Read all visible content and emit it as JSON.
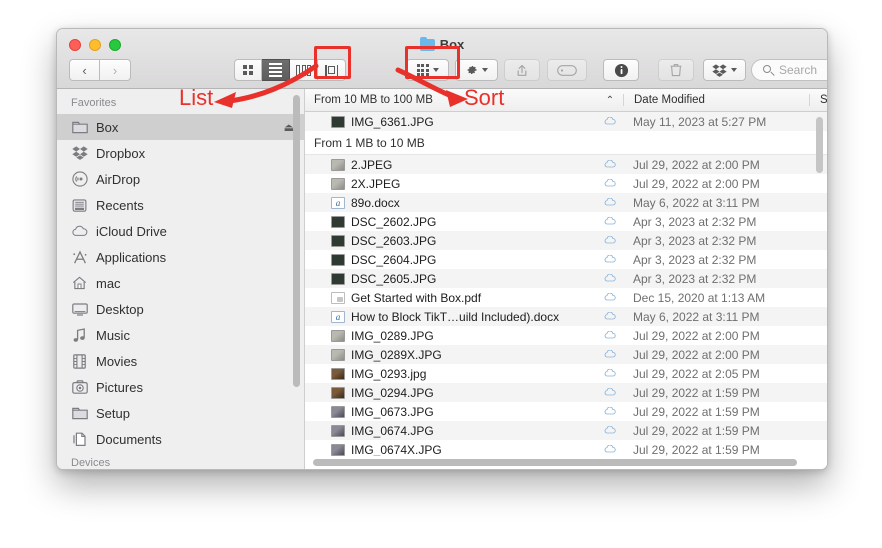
{
  "window": {
    "title": "Box",
    "title_icon": "folder-icon",
    "traffic_lights": [
      "close-button",
      "minimize-button",
      "maximize-button"
    ]
  },
  "toolbar": {
    "back_label": "‹",
    "forward_label": "›",
    "view_modes": [
      {
        "name": "icon-view",
        "label": "Icon View",
        "active": false
      },
      {
        "name": "list-view",
        "label": "List View",
        "active": true
      },
      {
        "name": "column-view",
        "label": "Column View",
        "active": false
      },
      {
        "name": "gallery-view",
        "label": "Gallery View",
        "active": false
      }
    ],
    "sort_button": "Sort",
    "action_button": "Action",
    "share_button": "Share",
    "tag_button": "Tags",
    "info_button": "Info",
    "delete_button": "Delete",
    "dropbox_button": "Dropbox"
  },
  "search": {
    "placeholder": "Search",
    "value": "",
    "icon": "search-icon"
  },
  "sidebar": {
    "section_title": "Favorites",
    "bottom_section_title": "Devices",
    "items": [
      {
        "label": "Box",
        "icon": "folder-icon",
        "selected": true,
        "eject": true
      },
      {
        "label": "Dropbox",
        "icon": "dropbox-icon",
        "selected": false,
        "eject": false
      },
      {
        "label": "AirDrop",
        "icon": "airdrop-icon",
        "selected": false,
        "eject": false
      },
      {
        "label": "Recents",
        "icon": "recents-icon",
        "selected": false,
        "eject": false
      },
      {
        "label": "iCloud Drive",
        "icon": "cloud-icon",
        "selected": false,
        "eject": false
      },
      {
        "label": "Applications",
        "icon": "applications-icon",
        "selected": false,
        "eject": false
      },
      {
        "label": "mac",
        "icon": "home-icon",
        "selected": false,
        "eject": false
      },
      {
        "label": "Desktop",
        "icon": "desktop-icon",
        "selected": false,
        "eject": false
      },
      {
        "label": "Music",
        "icon": "music-icon",
        "selected": false,
        "eject": false
      },
      {
        "label": "Movies",
        "icon": "movies-icon",
        "selected": false,
        "eject": false
      },
      {
        "label": "Pictures",
        "icon": "pictures-icon",
        "selected": false,
        "eject": false
      },
      {
        "label": "Setup",
        "icon": "folder-icon",
        "selected": false,
        "eject": false
      },
      {
        "label": "Documents",
        "icon": "documents-icon",
        "selected": false,
        "eject": false
      }
    ]
  },
  "filelist": {
    "columns": {
      "name": "From 10 MB to 100 MB",
      "sort_indicator": "⌃",
      "date": "Date Modified",
      "size": "S"
    },
    "groups": [
      {
        "header": "From 10 MB to 100 MB",
        "is_header_row": false,
        "rows": [
          {
            "name": "IMG_6361.JPG",
            "icon": "photo-dark",
            "cloud": "cloud-status-icon",
            "date": "May 11, 2023 at 5:27 PM",
            "size": ""
          }
        ]
      },
      {
        "header": "From 1 MB to 10 MB",
        "is_header_row": true,
        "rows": [
          {
            "name": "2.JPEG",
            "icon": "photo-grey",
            "cloud": "cloud-status-icon",
            "date": "Jul 29, 2022 at 2:00 PM",
            "size": ""
          },
          {
            "name": "2X.JPEG",
            "icon": "photo-grey",
            "cloud": "cloud-status-icon",
            "date": "Jul 29, 2022 at 2:00 PM",
            "size": ""
          },
          {
            "name": "89o.docx",
            "icon": "doc-word",
            "cloud": "cloud-status-icon",
            "date": "May 6, 2022 at 3:11 PM",
            "size": ""
          },
          {
            "name": "DSC_2602.JPG",
            "icon": "photo-dark",
            "cloud": "cloud-status-icon",
            "date": "Apr 3, 2023 at 2:32 PM",
            "size": ""
          },
          {
            "name": "DSC_2603.JPG",
            "icon": "photo-dark",
            "cloud": "cloud-status-icon",
            "date": "Apr 3, 2023 at 2:32 PM",
            "size": ""
          },
          {
            "name": "DSC_2604.JPG",
            "icon": "photo-dark",
            "cloud": "cloud-status-icon",
            "date": "Apr 3, 2023 at 2:32 PM",
            "size": ""
          },
          {
            "name": "DSC_2605.JPG",
            "icon": "photo-dark",
            "cloud": "cloud-status-icon",
            "date": "Apr 3, 2023 at 2:32 PM",
            "size": ""
          },
          {
            "name": "Get Started with Box.pdf",
            "icon": "doc-pdf",
            "cloud": "cloud-status-icon",
            "date": "Dec 15, 2020 at 1:13 AM",
            "size": ""
          },
          {
            "name": "How to Block TikT…uild Included).docx",
            "icon": "doc-word",
            "cloud": "cloud-status-icon",
            "date": "May 6, 2022 at 3:11 PM",
            "size": ""
          },
          {
            "name": "IMG_0289.JPG",
            "icon": "photo-grey",
            "cloud": "cloud-status-icon",
            "date": "Jul 29, 2022 at 2:00 PM",
            "size": ""
          },
          {
            "name": "IMG_0289X.JPG",
            "icon": "photo-grey",
            "cloud": "cloud-status-icon",
            "date": "Jul 29, 2022 at 2:00 PM",
            "size": ""
          },
          {
            "name": "IMG_0293.jpg",
            "icon": "photo-warm",
            "cloud": "cloud-status-icon",
            "date": "Jul 29, 2022 at 2:05 PM",
            "size": ""
          },
          {
            "name": "IMG_0294.JPG",
            "icon": "photo-warm",
            "cloud": "cloud-status-icon",
            "date": "Jul 29, 2022 at 1:59 PM",
            "size": ""
          },
          {
            "name": "IMG_0673.JPG",
            "icon": "photo-blue",
            "cloud": "cloud-status-icon",
            "date": "Jul 29, 2022 at 1:59 PM",
            "size": ""
          },
          {
            "name": "IMG_0674.JPG",
            "icon": "photo-blue",
            "cloud": "cloud-status-icon",
            "date": "Jul 29, 2022 at 1:59 PM",
            "size": ""
          },
          {
            "name": "IMG_0674X.JPG",
            "icon": "photo-blue",
            "cloud": "cloud-status-icon",
            "date": "Jul 29, 2022 at 1:59 PM",
            "size": ""
          }
        ]
      }
    ]
  },
  "annotations": {
    "accent_color": "#e8312a",
    "list_label": "List",
    "sort_label": "Sort"
  }
}
